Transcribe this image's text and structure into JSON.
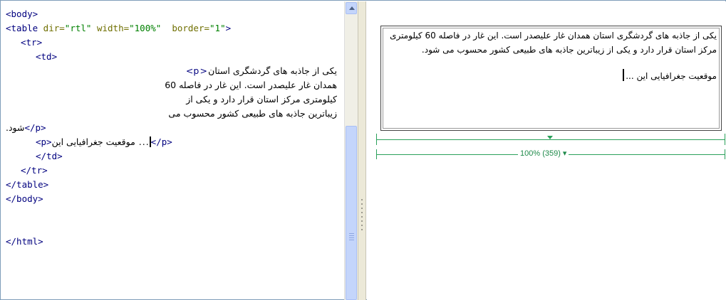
{
  "code_view": {
    "lines": {
      "l1": "<body>",
      "l2_tag_open": "<table",
      "l2_attr_dir": " dir=",
      "l2_val_dir": "\"rtl\"",
      "l2_attr_width": " width=",
      "l2_val_width": "\"100%\"",
      "l2_attr_border": "  border=",
      "l2_val_border": "\"1\"",
      "l2_tag_close": ">",
      "l3": "<tr>",
      "l4": "<td>",
      "l5_text": "یکی از جاذبه های گردشگری استان",
      "l5_tag": "<p>",
      "l6": "همدان غار علیصدر است. این غار در فاصله 60",
      "l7": "کیلومتری مرکز استان قرار دارد و یکی از",
      "l8": "زیباترین جاذبه های طبیعی کشور محسوب می",
      "l9_text": "شود.",
      "l9_tag": "</p>",
      "l10_tag_open": "<p>",
      "l10_text": "... موقعیت جغرافیایی این",
      "l10_tag_close": "</p>",
      "l11": "</td>",
      "l12": "</tr>",
      "l13": "</table>",
      "l14": "</body>",
      "l15": "</html>"
    }
  },
  "design_view": {
    "paragraph1": "یکی از جاذبه های گردشگری استان همدان غار علیصدر است. این غار در فاصله 60 کیلومتری مرکز استان قرار دارد و یکی از زیباترین جاذبه های طبیعی کشور محسوب می شود.",
    "paragraph2": "موقعیت جغرافیایی این ...",
    "width_label": "100% (359) ▾"
  },
  "colors": {
    "tag": "#00007f",
    "attribute": "#6f6f00",
    "value": "#008000",
    "ruler": "#2aa05a"
  }
}
